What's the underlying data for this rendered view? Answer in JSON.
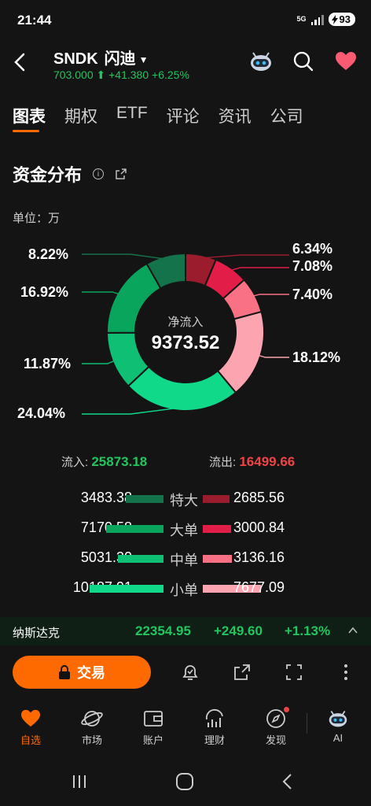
{
  "status": {
    "time": "21:44",
    "network": "5G",
    "battery": "93"
  },
  "header": {
    "symbol": "SNDK",
    "name": "闪迪",
    "price": "703.000",
    "change": "+41.380",
    "change_pct": "+6.25%"
  },
  "tabs": [
    "图表",
    "期权",
    "ETF",
    "评论",
    "资讯",
    "公司"
  ],
  "section": {
    "title": "资金分布",
    "unit": "单位：万"
  },
  "donut": {
    "center_label": "净流入",
    "center_value": "9373.52",
    "left_labels": [
      "8.22%",
      "16.92%",
      "11.87%",
      "24.04%"
    ],
    "right_labels": [
      "6.34%",
      "7.08%",
      "7.40%",
      "18.12%"
    ]
  },
  "chart_data": {
    "type": "pie",
    "segments": [
      {
        "name": "流出-特大",
        "value": 6.34,
        "color": "#9b1c2c"
      },
      {
        "name": "流出-大单",
        "value": 7.08,
        "color": "#e11d48"
      },
      {
        "name": "流出-中单",
        "value": 7.4,
        "color": "#f87185"
      },
      {
        "name": "流出-小单",
        "value": 18.12,
        "color": "#fca5b0"
      },
      {
        "name": "流入-小单",
        "value": 24.04,
        "color": "#10d98a"
      },
      {
        "name": "流入-中单",
        "value": 11.87,
        "color": "#0fbf74"
      },
      {
        "name": "流入-大单",
        "value": 16.92,
        "color": "#0aa55d"
      },
      {
        "name": "流入-特大",
        "value": 8.22,
        "color": "#15734c"
      }
    ]
  },
  "flow": {
    "in_label": "流入:",
    "in_value": "25873.18",
    "out_label": "流出:",
    "out_value": "16499.66"
  },
  "rows": [
    {
      "label": "特大",
      "in": "3483.38",
      "out": "2685.56",
      "in_frac": 0.34,
      "out_frac": 0.35,
      "in_color": "#15734c",
      "out_color": "#9b1c2c"
    },
    {
      "label": "大单",
      "in": "7170.58",
      "out": "3000.84",
      "in_frac": 0.7,
      "out_frac": 0.39,
      "in_color": "#0aa55d",
      "out_color": "#e11d48"
    },
    {
      "label": "中单",
      "in": "5031.30",
      "out": "3136.16",
      "in_frac": 0.49,
      "out_frac": 0.41,
      "in_color": "#0fbf74",
      "out_color": "#f87185"
    },
    {
      "label": "小单",
      "in": "10187.91",
      "out": "7677.09",
      "in_frac": 1.0,
      "out_frac": 1.0,
      "in_color": "#10d98a",
      "out_color": "#fca5b0"
    }
  ],
  "index": {
    "name": "纳斯达克",
    "value": "22354.95",
    "change": "+249.60",
    "change_pct": "+1.13%"
  },
  "actions": {
    "trade_label": "交易"
  },
  "nav": [
    "自选",
    "市场",
    "账户",
    "理财",
    "发现",
    "AI"
  ]
}
